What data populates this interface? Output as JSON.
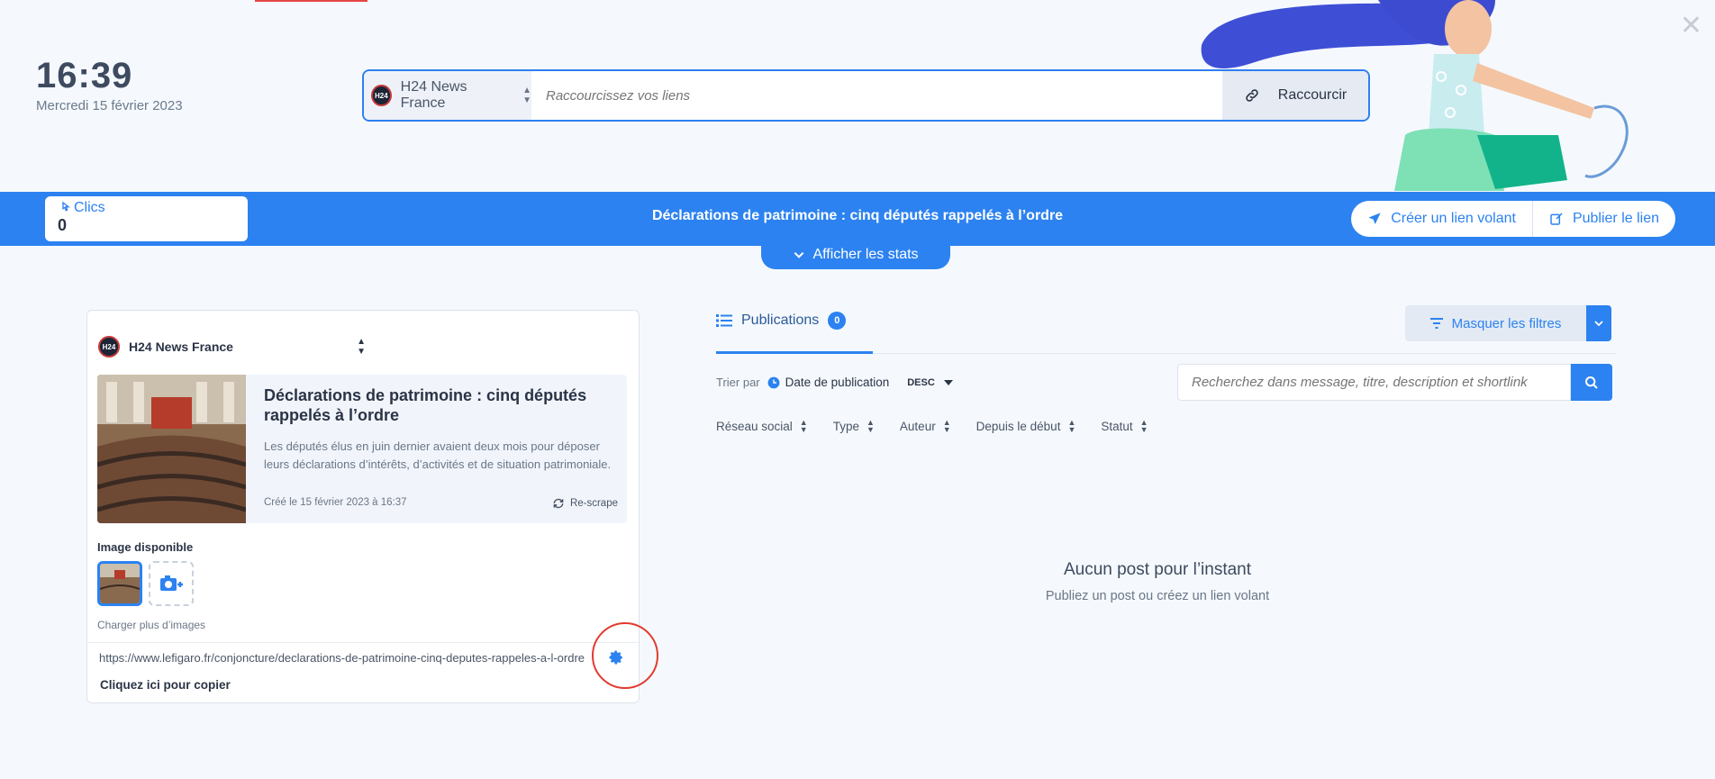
{
  "header": {
    "time": "16:39",
    "date": "Mercredi 15 février 2023"
  },
  "shortener": {
    "account_name": "H24 News France",
    "logo_text": "H24",
    "placeholder": "Raccourcissez vos liens",
    "button_label": "Raccourcir"
  },
  "bar": {
    "clicks_label": "Clics",
    "clicks_value": "0",
    "title": "Déclarations de patrimoine : cinq députés rappelés à l’ordre",
    "create_label": "Créer un lien volant",
    "publish_label": "Publier le lien",
    "stats_label": "Afficher les stats"
  },
  "card": {
    "account_name": "H24 News France",
    "logo_text": "H24",
    "title": "Déclarations de patrimoine : cinq députés rappelés à l’ordre",
    "description": "Les députés élus en juin dernier avaient deux mois pour déposer leurs déclarations d’intérêts, d’activités et de situation patrimoniale.",
    "created": "Créé le 15 février 2023 à 16:37",
    "rescrape_label": "Re-scrape",
    "image_label": "Image disponible",
    "more_images_label": "Charger plus d’images",
    "url": "https://www.lefigaro.fr/conjoncture/declarations-de-patrimoine-cinq-deputes-rappeles-a-l-ordre",
    "copy_label": "Cliquez ici pour copier"
  },
  "publications": {
    "tab_label": "Publications",
    "count": "0",
    "filters_button": "Masquer les filtres",
    "sort_by_label": "Trier par",
    "sort_field": "Date de publication",
    "sort_dir": "DESC",
    "search_placeholder": "Recherchez dans message, titre, description et shortlink",
    "filters": [
      "Réseau social",
      "Type",
      "Auteur",
      "Depuis le début",
      "Statut"
    ],
    "empty_title": "Aucun post pour l’instant",
    "empty_subtitle": "Publiez un post ou créez un lien volant"
  },
  "colors": {
    "accent": "#2c82f0",
    "background": "#f5f9fd",
    "highlight_circle": "#e23b2e"
  }
}
